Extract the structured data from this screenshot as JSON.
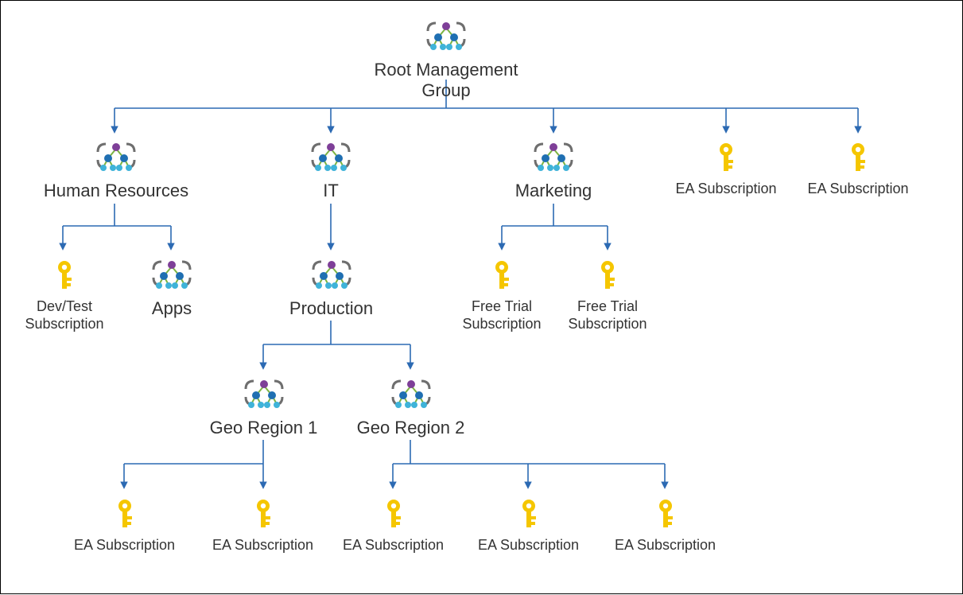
{
  "root": {
    "label": "Root Management Group"
  },
  "hr": {
    "label": "Human Resources"
  },
  "it": {
    "label": "IT"
  },
  "marketing": {
    "label": "Marketing"
  },
  "ea_top1": {
    "label": "EA Subscription"
  },
  "ea_top2": {
    "label": "EA Subscription"
  },
  "devtest": {
    "label": "Dev/Test Subscription"
  },
  "apps": {
    "label": "Apps"
  },
  "production": {
    "label": "Production"
  },
  "free1": {
    "label": "Free Trial Subscription"
  },
  "free2": {
    "label": "Free Trial Subscription"
  },
  "geo1": {
    "label": "Geo Region 1"
  },
  "geo2": {
    "label": "Geo Region 2"
  },
  "geo1_ea1": {
    "label": "EA Subscription"
  },
  "geo1_ea2": {
    "label": "EA Subscription"
  },
  "geo2_ea1": {
    "label": "EA Subscription"
  },
  "geo2_ea2": {
    "label": "EA Subscription"
  },
  "geo2_ea3": {
    "label": "EA Subscription"
  },
  "colors": {
    "connector": "#2c6ab3",
    "key": "#f5c600",
    "bracket": "#6e6e6e",
    "dot_purple": "#7e3f98",
    "dot_blue": "#1f6fb2",
    "dot_cyan": "#3fb3d9",
    "edge": "#7cb342"
  }
}
